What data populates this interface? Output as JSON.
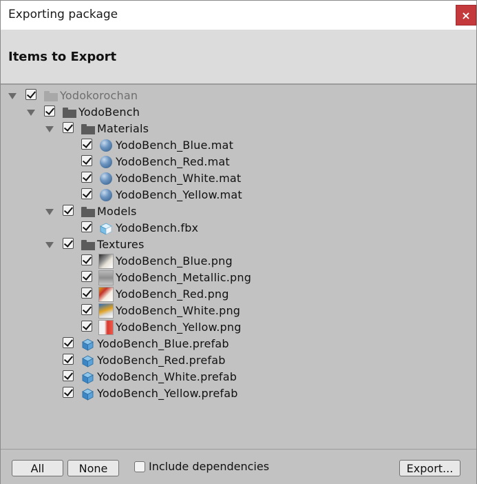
{
  "window": {
    "title": "Exporting package",
    "close_glyph": "×"
  },
  "header": {
    "title": "Items to Export"
  },
  "tree": {
    "root": {
      "label": "Yodokorochan",
      "checked": true,
      "expanded": true,
      "icon": "folder-icon"
    },
    "yodobench": {
      "label": "YodoBench",
      "checked": true,
      "expanded": true,
      "icon": "folder-icon"
    },
    "materials": {
      "label": "Materials",
      "checked": true,
      "expanded": true,
      "icon": "folder-icon",
      "items": [
        {
          "label": "YodoBench_Blue.mat",
          "checked": true,
          "icon": "material-sphere-icon"
        },
        {
          "label": "YodoBench_Red.mat",
          "checked": true,
          "icon": "material-sphere-icon"
        },
        {
          "label": "YodoBench_White.mat",
          "checked": true,
          "icon": "material-sphere-icon"
        },
        {
          "label": "YodoBench_Yellow.mat",
          "checked": true,
          "icon": "material-sphere-icon"
        }
      ]
    },
    "models": {
      "label": "Models",
      "checked": true,
      "expanded": true,
      "icon": "folder-icon",
      "items": [
        {
          "label": "YodoBench.fbx",
          "checked": true,
          "icon": "model-icon"
        }
      ]
    },
    "textures": {
      "label": "Textures",
      "checked": true,
      "expanded": true,
      "icon": "folder-icon",
      "items": [
        {
          "label": "YodoBench_Blue.png",
          "checked": true,
          "icon": "texture-thumbnail-icon"
        },
        {
          "label": "YodoBench_Metallic.png",
          "checked": true,
          "icon": "texture-thumbnail-icon"
        },
        {
          "label": "YodoBench_Red.png",
          "checked": true,
          "icon": "texture-thumbnail-icon"
        },
        {
          "label": "YodoBench_White.png",
          "checked": true,
          "icon": "texture-thumbnail-icon"
        },
        {
          "label": "YodoBench_Yellow.png",
          "checked": true,
          "icon": "texture-thumbnail-icon"
        }
      ]
    },
    "prefabs": [
      {
        "label": "YodoBench_Blue.prefab",
        "checked": true,
        "icon": "prefab-icon"
      },
      {
        "label": "YodoBench_Red.prefab",
        "checked": true,
        "icon": "prefab-icon"
      },
      {
        "label": "YodoBench_White.prefab",
        "checked": true,
        "icon": "prefab-icon"
      },
      {
        "label": "YodoBench_Yellow.prefab",
        "checked": true,
        "icon": "prefab-icon"
      }
    ]
  },
  "footer": {
    "all_label": "All",
    "none_label": "None",
    "include_dependencies_label": "Include dependencies",
    "include_dependencies_checked": false,
    "export_label": "Export..."
  },
  "colors": {
    "close_button": "#c4393c",
    "panel_background": "#c2c2c2",
    "header_background": "#dcdcdc"
  }
}
